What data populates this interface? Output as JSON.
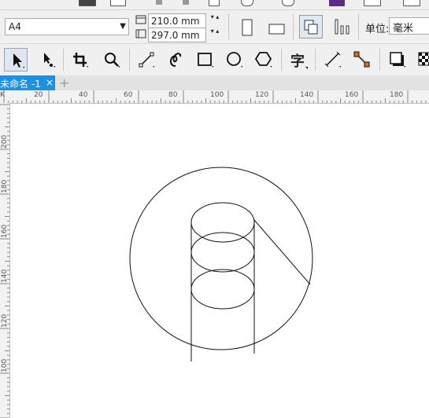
{
  "property_bar": {
    "paper_size": "A4",
    "width_value": "210.0 mm",
    "height_value": "297.0 mm",
    "units_label": "单位:",
    "units_value": "毫米"
  },
  "toolbox": {
    "text_tool_glyph": "字",
    "tools": [
      "pick-tool",
      "shape-tool",
      "crop-tool",
      "zoom-tool",
      "freehand-tool",
      "artistic-media-tool",
      "rectangle-tool",
      "ellipse-tool",
      "polygon-tool",
      "text-tool",
      "parallel-dimension-tool",
      "connector-tool",
      "drop-shadow-tool",
      "transparency-tool"
    ]
  },
  "document_tab": {
    "title": "未命名 -1",
    "close_glyph": "×",
    "add_glyph": "+"
  },
  "ruler_h_labels": [
    "20",
    "40",
    "60",
    "80",
    "100",
    "120",
    "140",
    "160",
    "180"
  ],
  "ruler_v_labels": [
    "200",
    "180",
    "160",
    "140",
    "120",
    "100"
  ],
  "ruler_corner_label": "K"
}
